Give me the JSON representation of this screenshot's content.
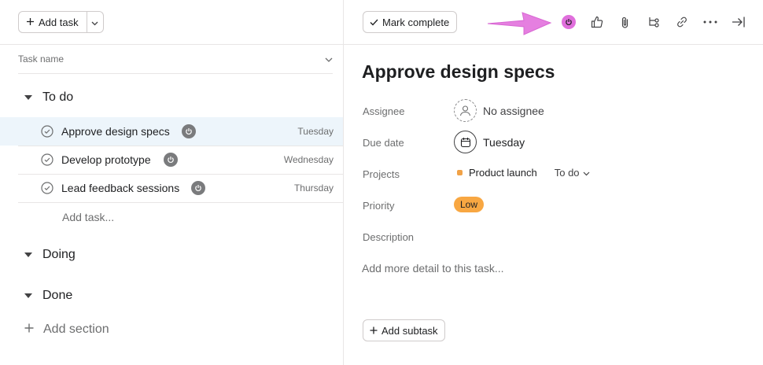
{
  "list": {
    "add_task_label": "Add task",
    "column_task_name": "Task name",
    "sections": [
      {
        "name": "To do",
        "tasks": [
          {
            "name": "Approve design specs",
            "due": "Tuesday"
          },
          {
            "name": "Develop prototype",
            "due": "Wednesday"
          },
          {
            "name": "Lead feedback sessions",
            "due": "Thursday"
          }
        ],
        "add_task_placeholder": "Add task..."
      },
      {
        "name": "Doing"
      },
      {
        "name": "Done"
      }
    ],
    "add_section_label": "Add section"
  },
  "detail": {
    "mark_complete_label": "Mark complete",
    "toolbar_icons": [
      "power-icon",
      "thumbs-up-icon",
      "paperclip-icon",
      "subtask-icon",
      "link-icon",
      "more-icon",
      "close-pane-icon"
    ],
    "title": "Approve design specs",
    "fields": {
      "assignee_label": "Assignee",
      "assignee_value": "No assignee",
      "due_date_label": "Due date",
      "due_date_value": "Tuesday",
      "projects_label": "Projects",
      "project_name": "Product launch",
      "project_section": "To do",
      "priority_label": "Priority",
      "priority_value": "Low",
      "description_label": "Description"
    },
    "description_placeholder": "Add more detail to this task...",
    "add_subtask_label": "Add subtask"
  },
  "colors": {
    "accent_pink": "#e06fdc",
    "arrow_pink": "#e57fe0",
    "priority_low": "#f8a742",
    "project_dot": "#f1a247",
    "selected_row": "#edf5fb"
  }
}
